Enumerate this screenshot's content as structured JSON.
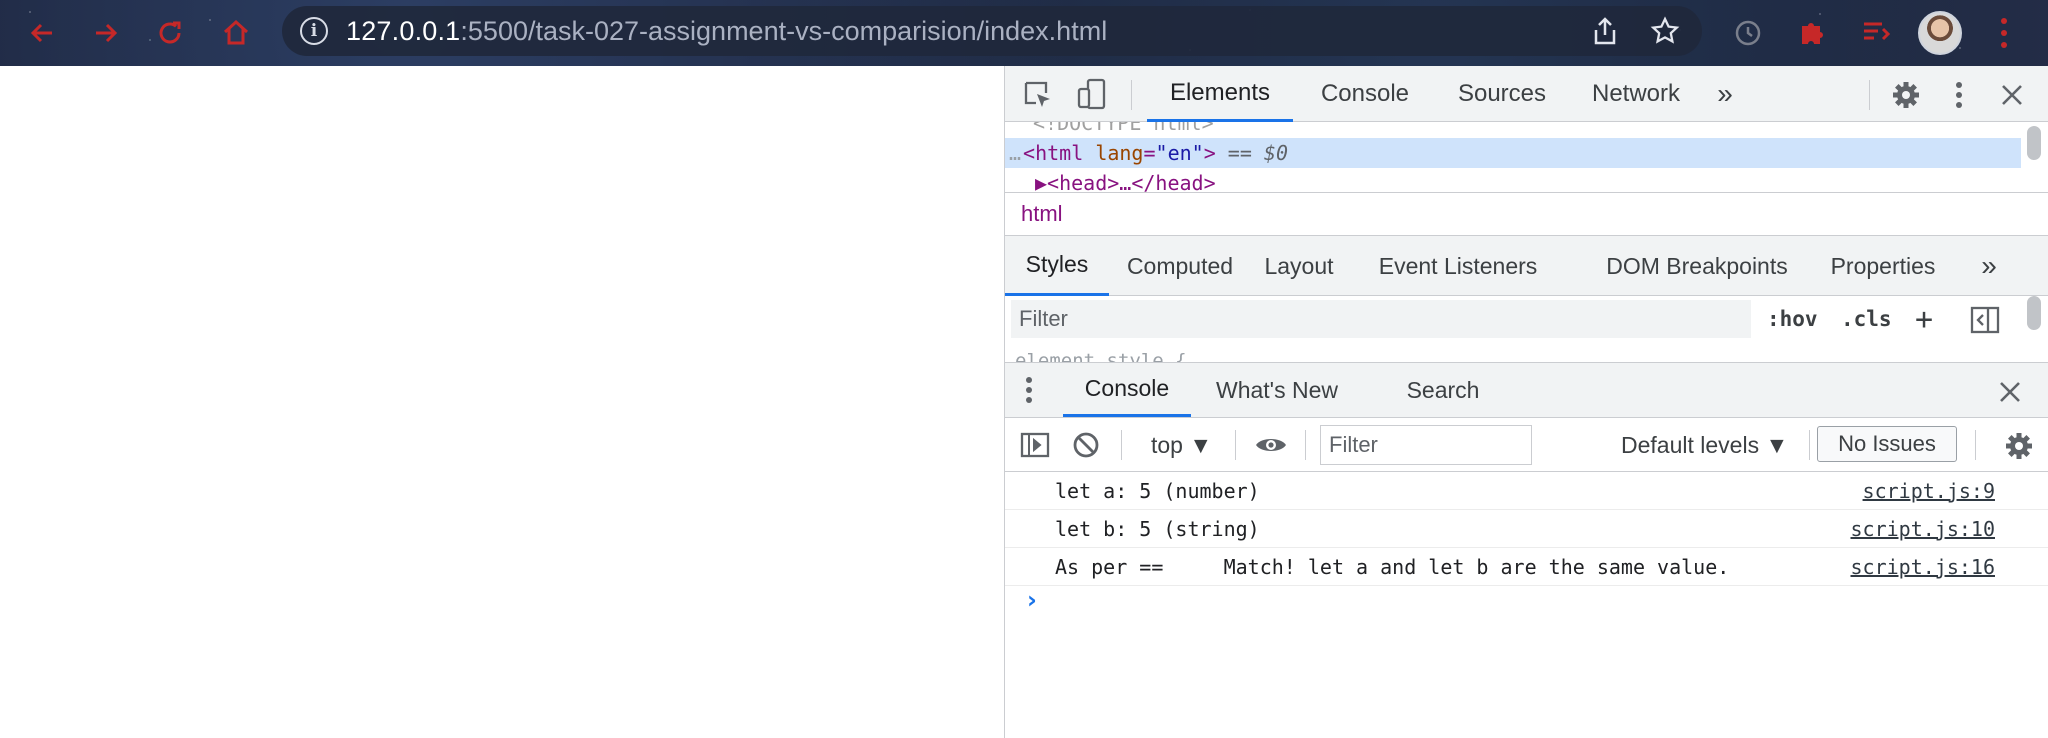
{
  "browser": {
    "url_host": "127.0.0.1",
    "url_path": ":5500/task-027-assignment-vs-comparision/index.html"
  },
  "devtools": {
    "main_tabs": [
      "Elements",
      "Console",
      "Sources",
      "Network"
    ],
    "more_tabs_glyph": "»",
    "dom_lines": {
      "doctype": "<!DOCTYPE html>",
      "html_open_tag": "<html",
      "html_attr_name": "lang",
      "html_attr_value": "\"en\"",
      "html_close": ">",
      "html_equals": " == ",
      "html_ref": "$0",
      "head": "▶<head>…</head>"
    },
    "breadcrumb": "html",
    "styles_tabs": [
      "Styles",
      "Computed",
      "Layout",
      "Event Listeners",
      "DOM Breakpoints",
      "Properties"
    ],
    "styles_filter_placeholder": "Filter",
    "hov_label": ":hov",
    "cls_label": ".cls",
    "add_label": "+",
    "element_style_text": "element.style {",
    "drawer_tabs": [
      "Console",
      "What's New",
      "Search"
    ],
    "console_toolbar": {
      "context": "top ▼",
      "filter_placeholder": "Filter",
      "levels": "Default levels ▼",
      "issues": "No Issues"
    },
    "messages": [
      {
        "text": "let a: 5 (number)",
        "source": "script.js:9"
      },
      {
        "text": "let b: 5 (string)",
        "source": "script.js:10"
      },
      {
        "text": "As per ==     Match! let a and let b are the same value.",
        "source": "script.js:16"
      }
    ],
    "prompt": "›"
  }
}
